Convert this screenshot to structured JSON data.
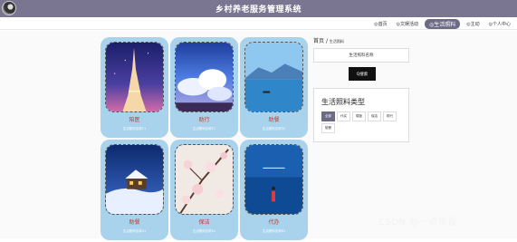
{
  "header": {
    "title": "乡村养老服务管理系统"
  },
  "nav": {
    "items": [
      {
        "label": "◎首页",
        "active": false
      },
      {
        "label": "◎文娱活动",
        "active": false
      },
      {
        "label": "◎生活照料",
        "active": true
      },
      {
        "label": "◎主动",
        "active": false
      },
      {
        "label": "◎个人中心",
        "active": false
      }
    ]
  },
  "cards": [
    {
      "title": "陪医",
      "sub": "生活照料名称11",
      "scene": "eiffel"
    },
    {
      "title": "助行",
      "sub": "生活照料名称21",
      "scene": "clouds"
    },
    {
      "title": "助餐",
      "sub": "生活照料名称31",
      "scene": "lake"
    },
    {
      "title": "助餐",
      "sub": "生活照料名称41",
      "scene": "snowhouse"
    },
    {
      "title": "保洁",
      "sub": "生活照料名称51",
      "scene": "blossom"
    },
    {
      "title": "代办",
      "sub": "生活照料名称61",
      "scene": "sea"
    }
  ],
  "sidebar": {
    "breadcrumb_home": "首页",
    "breadcrumb_sep": "/",
    "breadcrumb_current": "生活照料",
    "search_placeholder": "生活照料名称",
    "search_button": "Q搜索",
    "category_title": "生活照料类型",
    "categories": [
      {
        "label": "全部",
        "active": true
      },
      {
        "label": "代买",
        "active": false
      },
      {
        "label": "喂饭",
        "active": false
      },
      {
        "label": "保洁",
        "active": false
      },
      {
        "label": "助行",
        "active": false
      },
      {
        "label": "陪餐",
        "active": false
      }
    ]
  },
  "watermark": "CSDN @一点毕设"
}
